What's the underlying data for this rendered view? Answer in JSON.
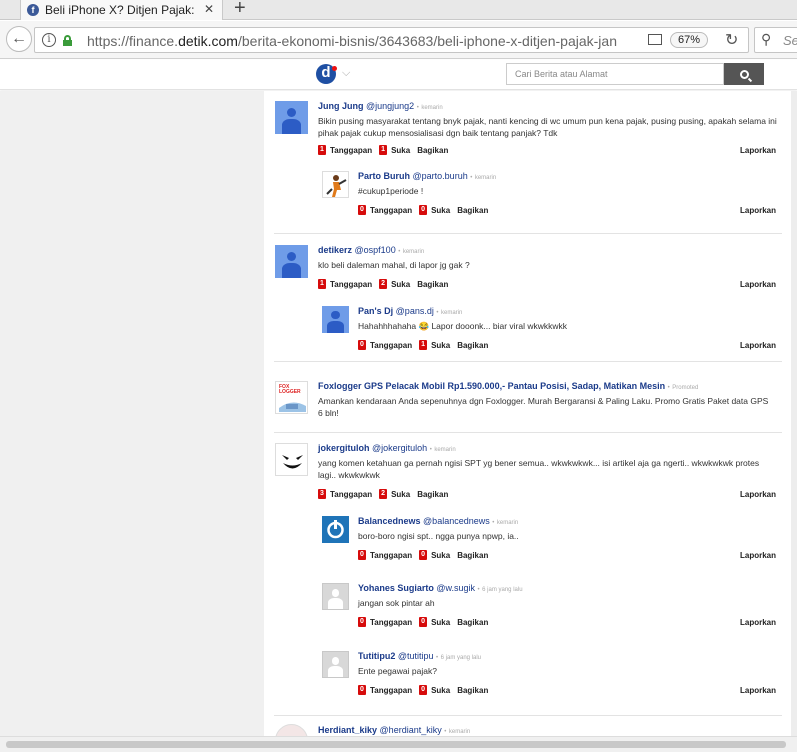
{
  "browser": {
    "tab_title": "Beli iPhone X? Ditjen Pajak: J",
    "tab_icon_letter": "f",
    "url_prefix": "https://finance.",
    "url_domain": "detik.com",
    "url_path": "/berita-ekonomi-bisnis/3643683/beli-iphone-x-ditjen-pajak-jan",
    "zoom": "67%",
    "search_placeholder": "Se"
  },
  "site": {
    "logo_letter": "d",
    "search_placeholder": "Cari Berita atau Alamat"
  },
  "labels": {
    "reply": "Tanggapan",
    "like": "Suka",
    "share": "Bagikan",
    "report": "Laporkan",
    "sep": "•"
  },
  "comments": [
    {
      "name": "Jung Jung",
      "handle": "@jungjung2",
      "time": "kemarin",
      "text": "Bikin pusing masyarakat tentang bnyk pajak, nanti kencing di wc umum pun kena pajak, pusing pusing, apakah selama ini pihak pajak cukup mensosialisasi dgn baik tentang panjak? Tdk",
      "replies": "1",
      "likes": "1"
    },
    {
      "name": "Parto Buruh",
      "handle": "@parto.buruh",
      "time": "kemarin",
      "text": "#cukup1periode !",
      "replies": "0",
      "likes": "0"
    },
    {
      "name": "detikerz",
      "handle": "@ospf100",
      "time": "kemarin",
      "text": "klo beli daleman mahal, di lapor jg gak ?",
      "replies": "1",
      "likes": "2"
    },
    {
      "name": "Pan's Dj",
      "handle": "@pans.dj",
      "time": "kemarin",
      "text": "Hahahhhahaha 😂 Lapor dooonk... biar viral wkwkkwkk",
      "replies": "0",
      "likes": "1"
    },
    {
      "name": "Foxlogger GPS Pelacak Mobil Rp1.590.000,- Pantau Posisi, Sadap, Matikan Mesin",
      "handle": "",
      "time": "Promoted",
      "text": "Amankan kendaraan Anda sepenuhnya dgn Foxlogger. Murah Bergaransi & Paling Laku. Promo Gratis Paket data GPS 6 bln!",
      "avatar_text": "FOX LOGGER"
    },
    {
      "name": "jokergituloh",
      "handle": "@jokergituloh",
      "time": "kemarin",
      "text": "yang komen ketahuan ga pernah ngisi SPT yg bener semua.. wkwkwkwk... isi artikel aja ga ngerti.. wkwkwkwk protes lagi.. wkwkwkwk",
      "replies": "3",
      "likes": "2"
    },
    {
      "name": "Balancednews",
      "handle": "@balancednews",
      "time": "kemarin",
      "text": "boro-boro ngisi spt.. ngga punya npwp, ia..",
      "replies": "0",
      "likes": "0"
    },
    {
      "name": "Yohanes Sugiarto",
      "handle": "@w.sugik",
      "time": "6 jam yang lalu",
      "text": "jangan sok pintar ah",
      "replies": "0",
      "likes": "0"
    },
    {
      "name": "Tutitipu2",
      "handle": "@tutitipu",
      "time": "6 jam yang lalu",
      "text": "Ente pegawai pajak?",
      "replies": "0",
      "likes": "0"
    },
    {
      "name": "Herdiant_kiky",
      "handle": "@herdiant_kiky",
      "time": "kemarin"
    }
  ],
  "colors": {
    "link_name": "#1b3b8a",
    "badge_red": "#d60b0b",
    "logo_blue": "#1e4fa3"
  }
}
